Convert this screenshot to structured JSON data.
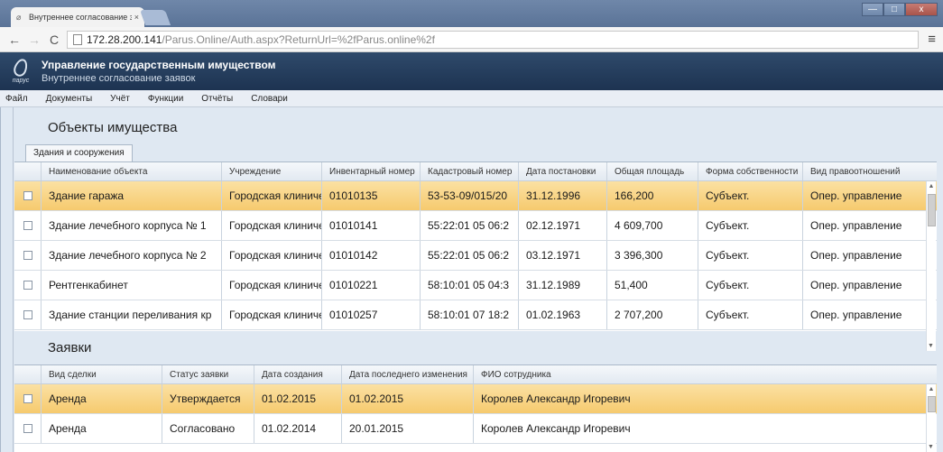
{
  "browser": {
    "tab_title": "Внутреннее согласование з...",
    "tab_close": "×",
    "url_host": "172.28.200.141",
    "url_path": "/Parus.Online/Auth.aspx?ReturnUrl=%2fParus.online%2f",
    "window_buttons": [
      "—",
      "□",
      "x"
    ]
  },
  "app": {
    "logo_text": "парус",
    "title": "Управление государственным имуществом",
    "subtitle": "Внутреннее согласование заявок"
  },
  "menu": [
    "Файл",
    "Документы",
    "Учёт",
    "Функции",
    "Отчёты",
    "Словари"
  ],
  "assets": {
    "title": "Объекты имущества",
    "tab": "Здания и сооружения",
    "columns": [
      "Наименование объекта",
      "Учреждение",
      "Инвентарный номер",
      "Кадастровый номер",
      "Дата постановки",
      "Общая площадь",
      "Форма собственности",
      "Вид правоотношений"
    ],
    "rows": [
      [
        "Здание гаража",
        "Городская клиниче",
        "01010135",
        "53-53-09/015/20",
        "31.12.1996",
        "166,200",
        "Субъект.",
        "Опер. управление"
      ],
      [
        "Здание лечебного корпуса № 1",
        "Городская клиниче",
        "01010141",
        "55:22:01 05 06:2",
        "02.12.1971",
        "4 609,700",
        "Субъект.",
        "Опер. управление"
      ],
      [
        "Здание лечебного корпуса № 2",
        "Городская клиниче",
        "01010142",
        "55:22:01 05 06:2",
        "03.12.1971",
        "3 396,300",
        "Субъект.",
        "Опер. управление"
      ],
      [
        "Рентгенкабинет",
        "Городская клиниче",
        "01010221",
        "58:10:01 05 04:3",
        "31.12.1989",
        "51,400",
        "Субъект.",
        "Опер. управление"
      ],
      [
        "Здание станции переливания кр",
        "Городская клиниче",
        "01010257",
        "58:10:01 07 18:2",
        "01.02.1963",
        "2 707,200",
        "Субъект.",
        "Опер. управление"
      ]
    ]
  },
  "requests": {
    "title": "Заявки",
    "columns": [
      "Вид сделки",
      "Статус заявки",
      "Дата создания",
      "Дата последнего изменения",
      "ФИО сотрудника"
    ],
    "rows": [
      [
        "Аренда",
        "Утверждается",
        "01.02.2015",
        "01.02.2015",
        "Королев Александр Игоревич"
      ],
      [
        "Аренда",
        "Согласовано",
        "01.02.2014",
        "20.01.2015",
        "Королев Александр Игоревич"
      ]
    ]
  }
}
